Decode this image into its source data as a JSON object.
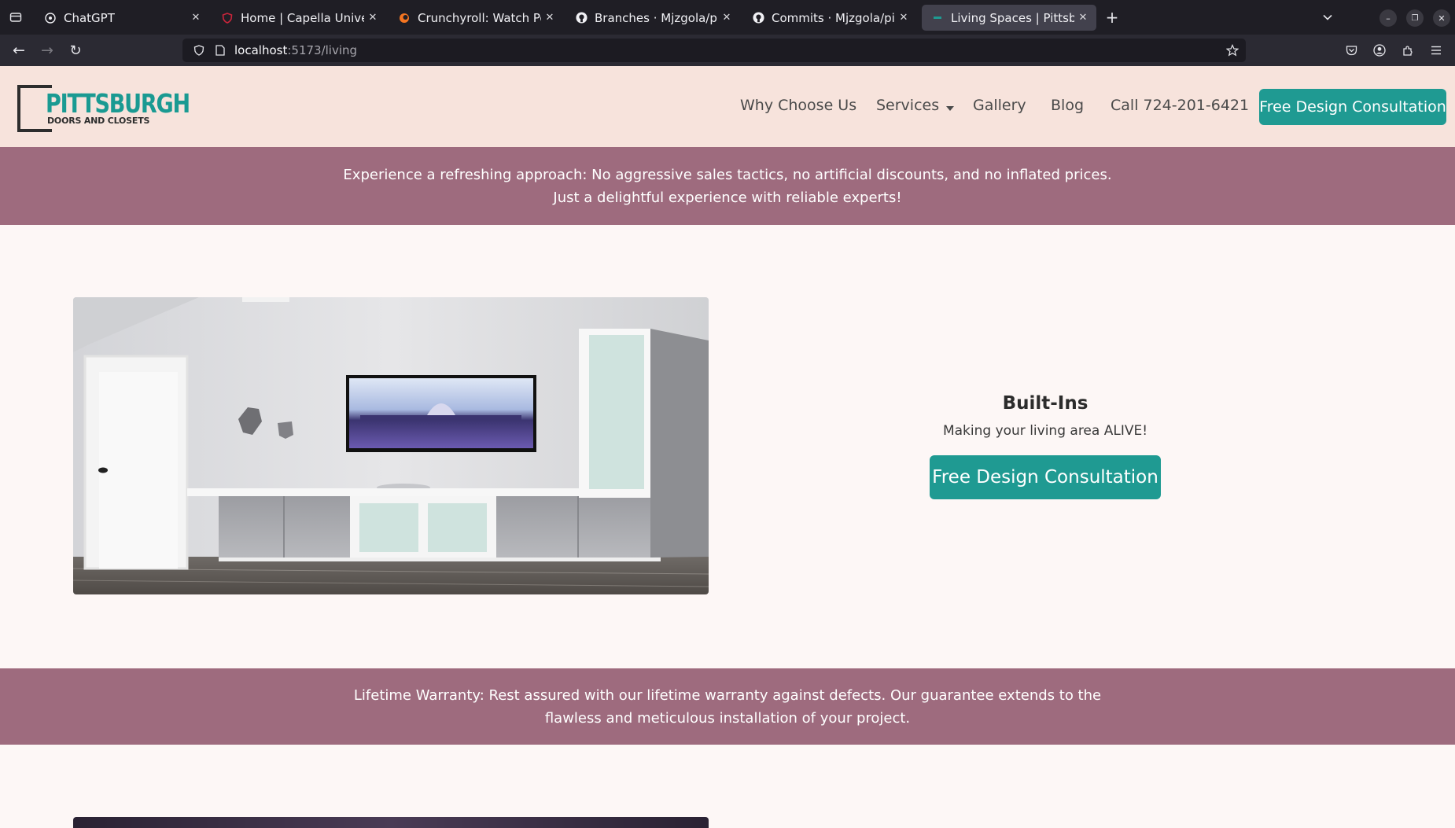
{
  "browser": {
    "tabs": [
      {
        "title": "ChatGPT",
        "icon": "chatgpt-icon"
      },
      {
        "title": "Home | Capella Universit",
        "icon": "shield-icon"
      },
      {
        "title": "Crunchyroll: Watch Popul",
        "icon": "crunchyroll-icon"
      },
      {
        "title": "Branches · Mjzgola/pittd",
        "icon": "github-icon"
      },
      {
        "title": "Commits · Mjzgola/pittd",
        "icon": "github-icon"
      },
      {
        "title": "Living Spaces | Pittsburg",
        "icon": "site-icon",
        "active": true
      }
    ],
    "url_host": "localhost",
    "url_path": ":5173/living"
  },
  "site": {
    "logo_main": "PITTSBURGH",
    "logo_sub": "DOORS AND CLOSETS",
    "nav": {
      "why": "Why Choose Us",
      "services": "Services",
      "gallery": "Gallery",
      "blog": "Blog",
      "call": "Call 724-201-6421",
      "cta": "Free Design Consultation"
    },
    "banner1": "Experience a refreshing approach: No aggressive sales tactics, no artificial discounts, and no inflated prices. Just a delightful experience with reliable experts!",
    "feature": {
      "title": "Built-Ins",
      "subtitle": "Making your living area ALIVE!",
      "cta": "Free Design Consultation"
    },
    "banner2": "Lifetime Warranty: Rest assured with our lifetime warranty against defects. Our guarantee extends to the flawless and meticulous installation of your project."
  },
  "colors": {
    "brand_teal": "#1f9a92",
    "header_bg": "#f7e3dc",
    "banner_bg": "#9e6b7e",
    "page_bg": "#fdf7f6"
  }
}
